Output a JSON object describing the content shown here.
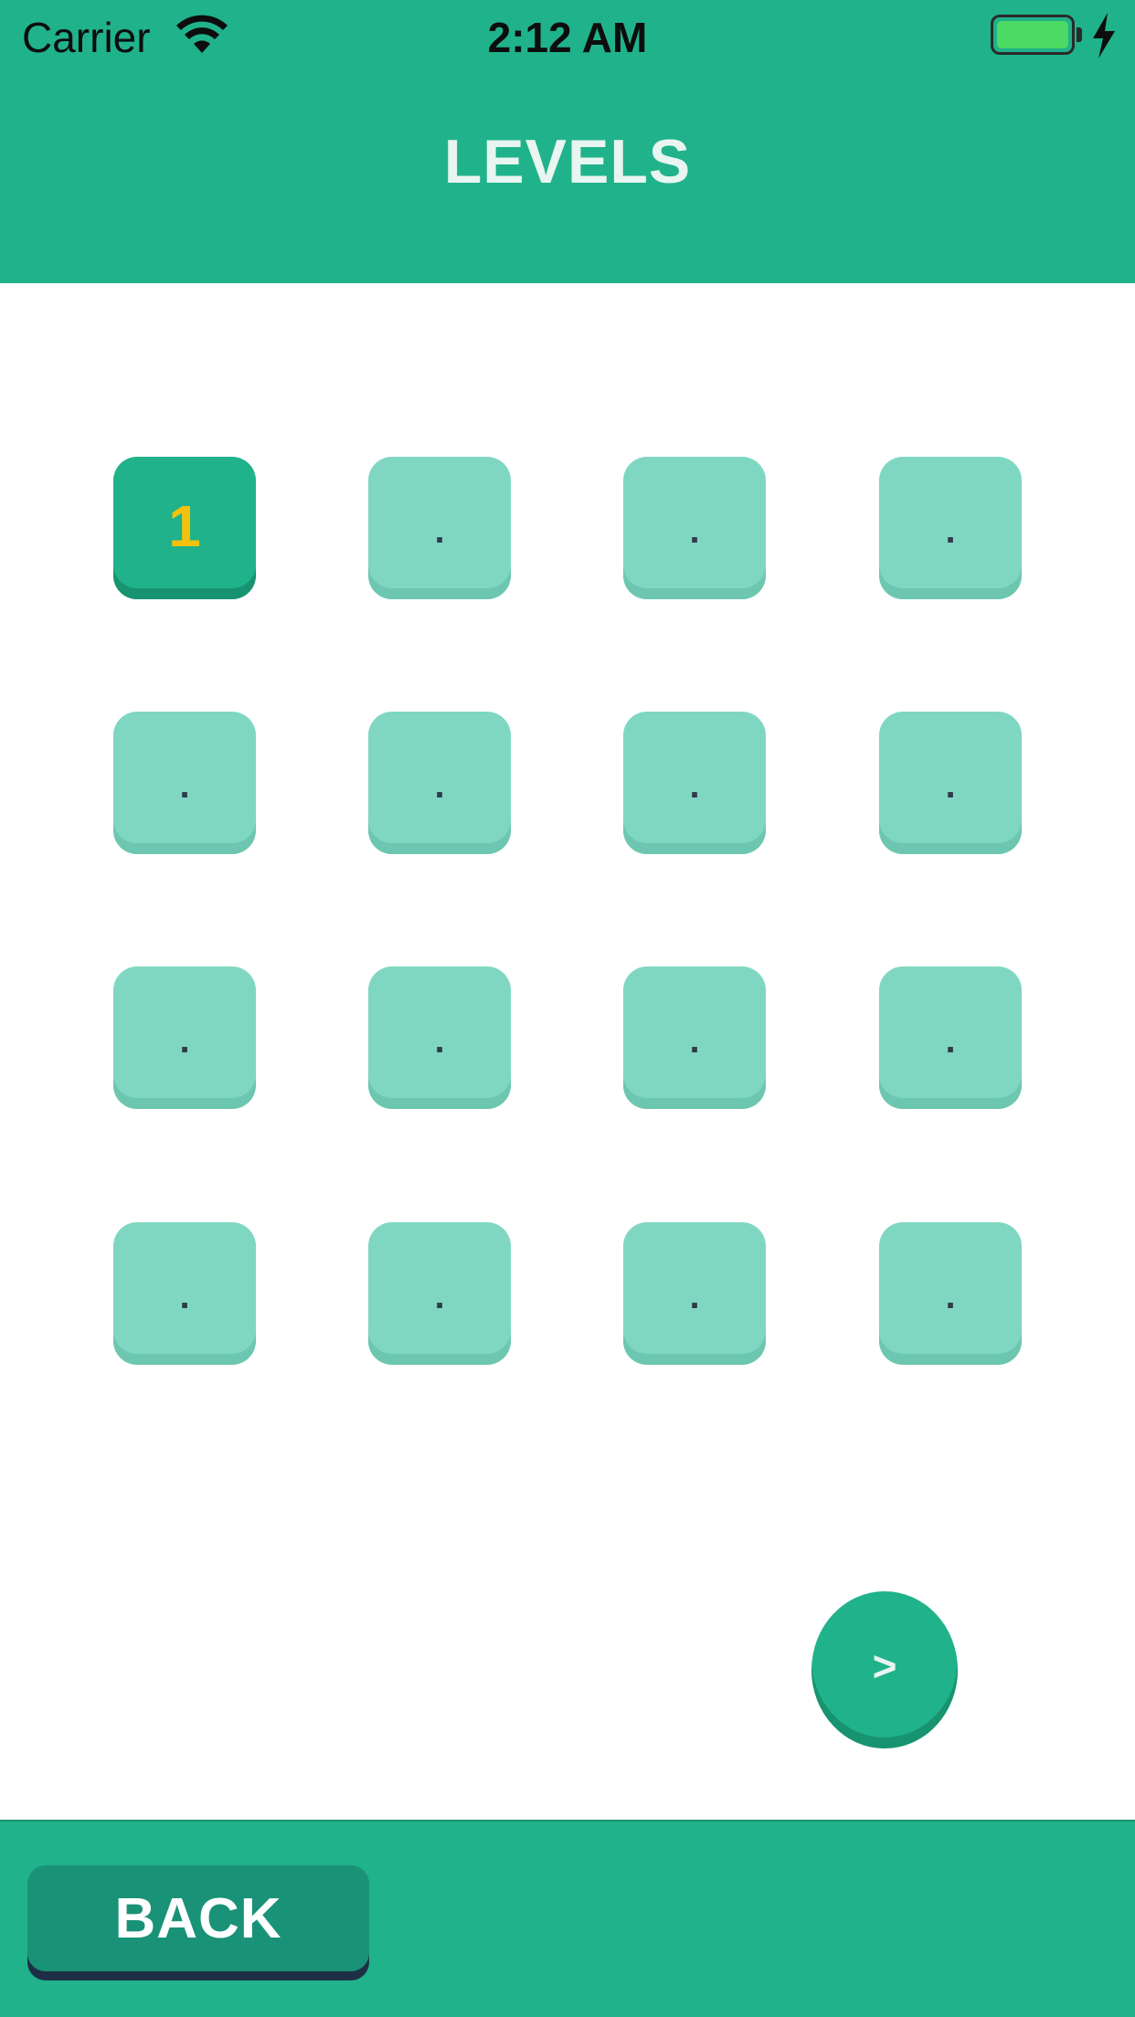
{
  "status_bar": {
    "carrier": "Carrier",
    "time": "2:12 AM",
    "wifi_icon": "wifi-icon",
    "battery_icon": "battery-charging-icon"
  },
  "header": {
    "title": "LEVELS"
  },
  "levels": {
    "tiles": [
      {
        "label": "1",
        "state": "unlocked"
      },
      {
        "label": ".",
        "state": "locked"
      },
      {
        "label": ".",
        "state": "locked"
      },
      {
        "label": ".",
        "state": "locked"
      },
      {
        "label": ".",
        "state": "locked"
      },
      {
        "label": ".",
        "state": "locked"
      },
      {
        "label": ".",
        "state": "locked"
      },
      {
        "label": ".",
        "state": "locked"
      },
      {
        "label": ".",
        "state": "locked"
      },
      {
        "label": ".",
        "state": "locked"
      },
      {
        "label": ".",
        "state": "locked"
      },
      {
        "label": ".",
        "state": "locked"
      },
      {
        "label": ".",
        "state": "locked"
      },
      {
        "label": ".",
        "state": "locked"
      },
      {
        "label": ".",
        "state": "locked"
      },
      {
        "label": ".",
        "state": "locked"
      }
    ]
  },
  "pager": {
    "next_label": ">"
  },
  "footer": {
    "back_label": "BACK"
  },
  "colors": {
    "primary": "#20b28b",
    "tile_locked": "#7fd7c2",
    "level_number": "#f4c20d",
    "dark_button": "#1a9277"
  }
}
